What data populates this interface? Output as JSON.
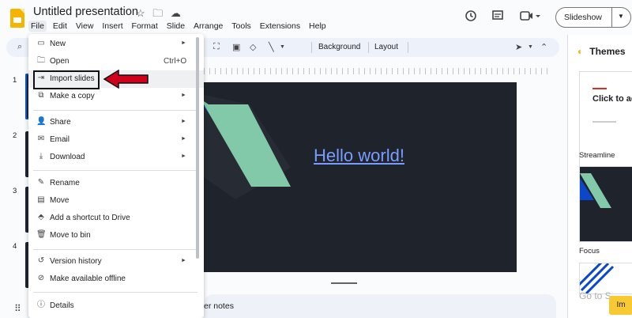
{
  "app": {
    "title": "Untitled presentation",
    "title_icons": [
      "star-icon",
      "folder-move-icon",
      "cloud-status-icon"
    ],
    "menu": [
      "File",
      "Edit",
      "View",
      "Insert",
      "Format",
      "Slide",
      "Arrange",
      "Tools",
      "Extensions",
      "Help"
    ],
    "active_menu": "File"
  },
  "header_actions": {
    "history_icon": "history-icon",
    "comments_icon": "comment-icon",
    "meet_icon": "video-camera-icon",
    "slideshow_label": "Slideshow"
  },
  "toolbar": {
    "background_label": "Background",
    "layout_label": "Layout"
  },
  "filmstrip": {
    "slide_numbers": [
      "1",
      "2",
      "3",
      "4"
    ],
    "selected": 1
  },
  "slide": {
    "title": "Hello world!",
    "accent_colors": [
      "#81c9a8",
      "#0d47c9"
    ],
    "background": "#1f232b"
  },
  "notes": {
    "label": "er notes"
  },
  "themes": {
    "heading": "Themes",
    "cards": [
      {
        "name": "Streamline",
        "preview_text": "Click to add"
      },
      {
        "name": "Focus",
        "preview_text": ""
      }
    ],
    "import_text": "Go to S",
    "import_button": "Im"
  },
  "file_menu": {
    "items": [
      {
        "label": "New",
        "icon": "new-presentation-icon",
        "submenu": true
      },
      {
        "label": "Open",
        "icon": "folder-open-icon",
        "shortcut": "Ctrl+O"
      },
      {
        "label": "Import slides",
        "icon": "import-icon",
        "highlighted": true
      },
      {
        "label": "Make a copy",
        "icon": "copy-icon",
        "submenu": true
      },
      {
        "label": "Share",
        "icon": "share-person-icon",
        "submenu": true
      },
      {
        "label": "Email",
        "icon": "email-icon",
        "submenu": true
      },
      {
        "label": "Download",
        "icon": "download-icon",
        "submenu": true
      },
      {
        "label": "Rename",
        "icon": "rename-icon"
      },
      {
        "label": "Move",
        "icon": "move-folder-icon"
      },
      {
        "label": "Add a shortcut to Drive",
        "icon": "drive-shortcut-icon"
      },
      {
        "label": "Move to bin",
        "icon": "trash-icon"
      },
      {
        "label": "Version history",
        "icon": "history-icon",
        "submenu": true
      },
      {
        "label": "Make available offline",
        "icon": "offline-icon"
      },
      {
        "label": "Details",
        "icon": "info-icon"
      }
    ]
  },
  "annotation": {
    "box_color": "#111111",
    "arrow_color": "#d0021b"
  }
}
